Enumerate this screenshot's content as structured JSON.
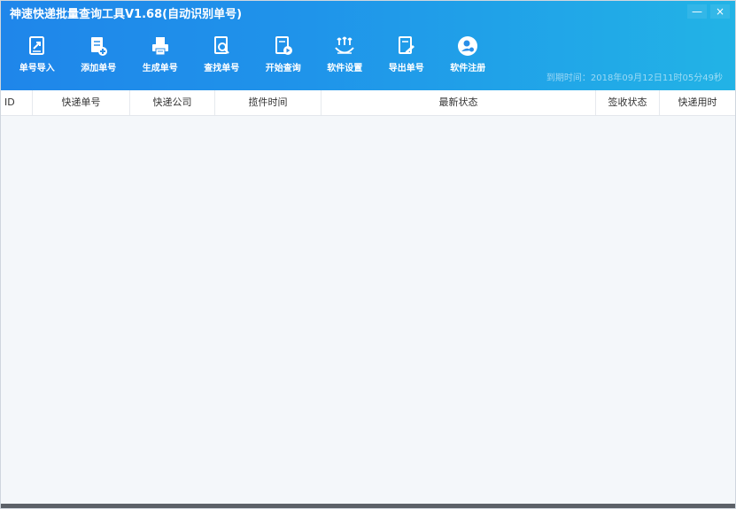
{
  "window": {
    "title": "神速快递批量查询工具V1.68(自动识别单号)",
    "minimize_label": "—",
    "close_label": "×"
  },
  "toolbar": {
    "items": [
      {
        "label": "单号导入",
        "icon": "import-icon"
      },
      {
        "label": "添加单号",
        "icon": "add-icon"
      },
      {
        "label": "生成单号",
        "icon": "printer-icon"
      },
      {
        "label": "查找单号",
        "icon": "search-icon"
      },
      {
        "label": "开始查询",
        "icon": "play-icon"
      },
      {
        "label": "软件设置",
        "icon": "settings-icon"
      },
      {
        "label": "导出单号",
        "icon": "export-icon"
      },
      {
        "label": "软件注册",
        "icon": "user-icon"
      }
    ]
  },
  "expire_text": "到期时间：2018年09月12日11时05分49秒",
  "table": {
    "columns": [
      {
        "label": "ID"
      },
      {
        "label": "快递单号"
      },
      {
        "label": "快递公司"
      },
      {
        "label": "揽件时间"
      },
      {
        "label": "最新状态"
      },
      {
        "label": "签收状态"
      },
      {
        "label": "快递用时"
      }
    ],
    "rows": []
  },
  "colors": {
    "titlebar_start": "#1f86ea",
    "titlebar_end": "#22b3e6",
    "body_bg": "#f4f7fa"
  }
}
